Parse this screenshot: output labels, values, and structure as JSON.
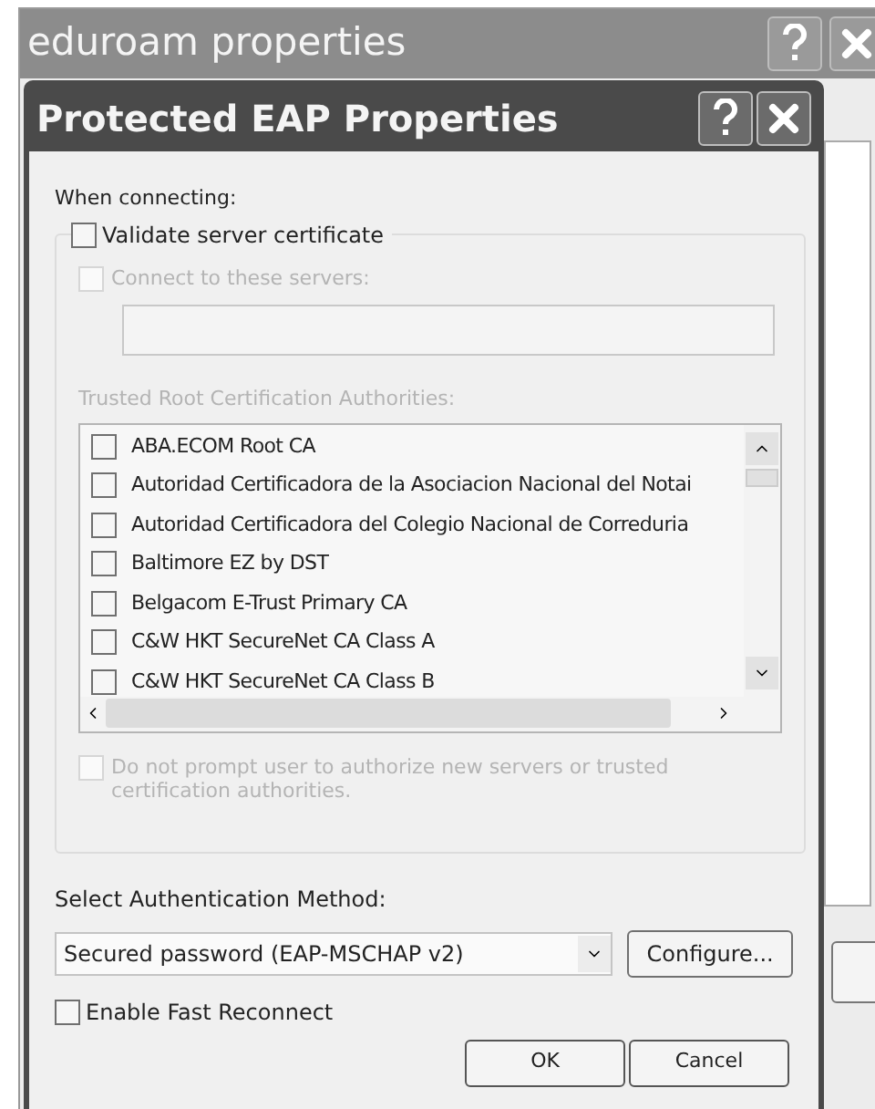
{
  "back_window": {
    "title": "eduroam properties"
  },
  "dialog": {
    "title": "Protected EAP Properties",
    "when_connecting": "When connecting:",
    "validate": {
      "label": "Validate server certificate",
      "checked": false
    },
    "connect_servers": {
      "label": "Connect to these servers:",
      "checked": false,
      "disabled": true
    },
    "trusted_label": "Trusted Root Certification Authorities:",
    "authorities": [
      {
        "name": "ABA.ECOM Root CA",
        "checked": false
      },
      {
        "name": "Autoridad Certificadora de la Asociacion Nacional del Notai",
        "checked": false
      },
      {
        "name": "Autoridad Certificadora del Colegio Nacional de Correduria",
        "checked": false
      },
      {
        "name": "Baltimore EZ by DST",
        "checked": false
      },
      {
        "name": "Belgacom E-Trust Primary CA",
        "checked": false
      },
      {
        "name": "C&W HKT SecureNet CA Class A",
        "checked": false
      },
      {
        "name": "C&W HKT SecureNet CA Class B",
        "checked": false
      }
    ],
    "no_prompt": {
      "label": "Do not prompt user to authorize new servers or trusted certification authorities.",
      "checked": false,
      "disabled": true
    },
    "method_label": "Select Authentication Method:",
    "method_value": "Secured password (EAP-MSCHAP v2)",
    "configure": "Configure...",
    "fast_reconnect": {
      "label": "Enable Fast Reconnect",
      "checked": false
    },
    "buttons": [
      "OK",
      "Cancel"
    ]
  }
}
